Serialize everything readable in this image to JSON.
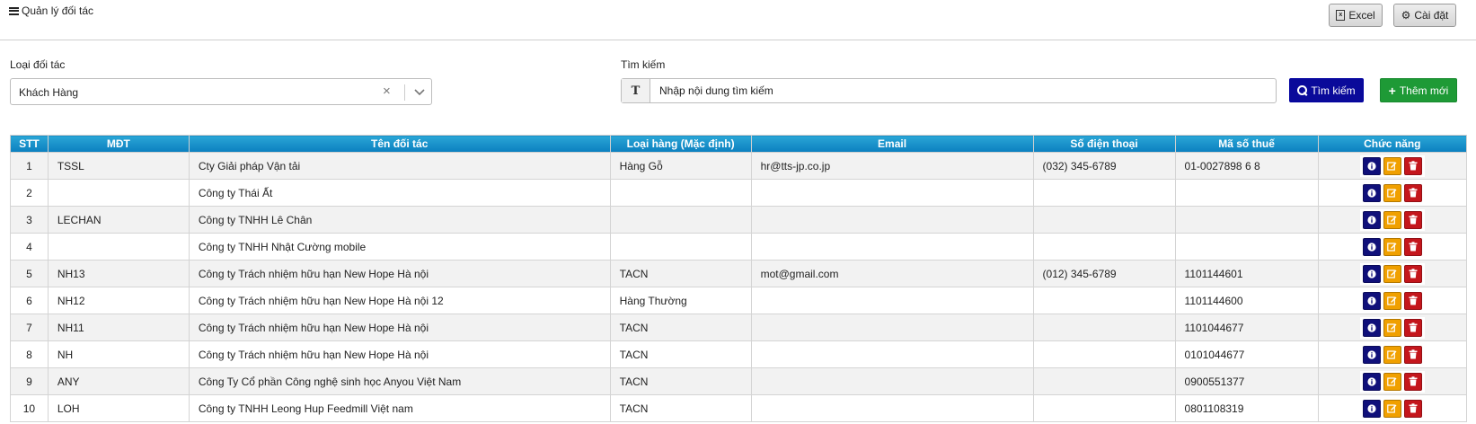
{
  "header": {
    "title": "Quản lý đối tác",
    "excel_label": "Excel",
    "settings_label": "Cài đặt"
  },
  "filter": {
    "partner_type_label": "Loại đối tác",
    "partner_type_value": "Khách Hàng",
    "search_label": "Tìm kiếm",
    "search_placeholder": "Nhập nội dung tìm kiếm",
    "search_value": "",
    "search_button": "Tìm kiếm",
    "add_button": "Thêm mới"
  },
  "table": {
    "columns": [
      "STT",
      "MĐT",
      "Tên đối tác",
      "Loại hàng (Mặc định)",
      "Email",
      "Số điện thoại",
      "Mã số thuế",
      "Chức năng"
    ],
    "rows": [
      {
        "stt": "1",
        "code": "TSSL",
        "name": "Cty Giải pháp Vận tải",
        "goods": "Hàng Gỗ",
        "email": "hr@tts-jp.co.jp",
        "phone": "(032) 345-6789",
        "tax": "01-0027898 6 8"
      },
      {
        "stt": "2",
        "code": "",
        "name": "Công ty Thái Ất",
        "goods": "",
        "email": "",
        "phone": "",
        "tax": ""
      },
      {
        "stt": "3",
        "code": "LECHAN",
        "name": "Công ty TNHH Lê Chân",
        "goods": "",
        "email": "",
        "phone": "",
        "tax": ""
      },
      {
        "stt": "4",
        "code": "",
        "name": "Công ty TNHH Nhật Cường mobile",
        "goods": "",
        "email": "",
        "phone": "",
        "tax": ""
      },
      {
        "stt": "5",
        "code": "NH13",
        "name": "Công ty Trách nhiệm hữu hạn New Hope Hà nội",
        "goods": "TACN",
        "email": "mot@gmail.com",
        "phone": "(012) 345-6789",
        "tax": "1101144601"
      },
      {
        "stt": "6",
        "code": "NH12",
        "name": "Công ty Trách nhiệm hữu hạn New Hope Hà nội 12",
        "goods": "Hàng Thường",
        "email": "",
        "phone": "",
        "tax": "1101144600"
      },
      {
        "stt": "7",
        "code": "NH11",
        "name": "Công ty Trách nhiệm hữu hạn New Hope Hà nội",
        "goods": "TACN",
        "email": "",
        "phone": "",
        "tax": "1101044677"
      },
      {
        "stt": "8",
        "code": "NH",
        "name": "Công ty Trách nhiệm hữu hạn New Hope Hà nội",
        "goods": "TACN",
        "email": "",
        "phone": "",
        "tax": "0101044677"
      },
      {
        "stt": "9",
        "code": "ANY",
        "name": "Công Ty Cổ phần Công nghệ sinh học Anyou Việt Nam",
        "goods": "TACN",
        "email": "",
        "phone": "",
        "tax": "0900551377"
      },
      {
        "stt": "10",
        "code": "LOH",
        "name": "Công ty TNHH Leong Hup Feedmill Việt nam",
        "goods": "TACN",
        "email": "",
        "phone": "",
        "tax": "0801108319"
      }
    ],
    "action_icons": [
      "info-icon",
      "edit-icon",
      "delete-icon"
    ]
  },
  "colors": {
    "header_gradient_top": "#2aa6d6",
    "header_gradient_bottom": "#0b7fbf",
    "search_button": "#0a0a9a",
    "add_button": "#1e9a36",
    "info_button": "#10107a",
    "edit_button": "#f0a000",
    "delete_button": "#c4161c"
  }
}
